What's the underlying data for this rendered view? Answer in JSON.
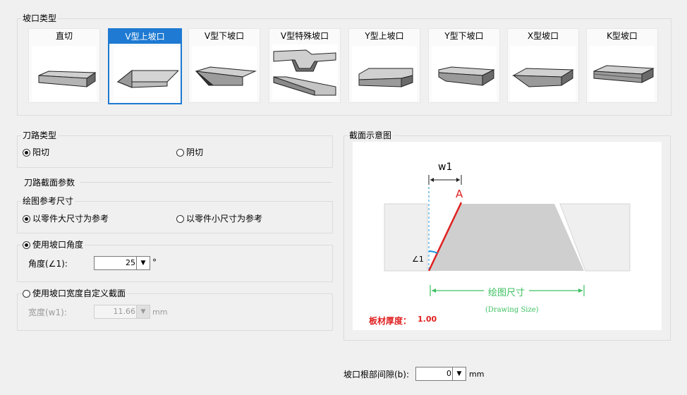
{
  "bevel_type": {
    "title": "坡口类型",
    "options": [
      {
        "label": "直切",
        "icon": "straight-cut-icon",
        "selected": false
      },
      {
        "label": "V型上坡口",
        "icon": "v-upper-bevel-icon",
        "selected": true
      },
      {
        "label": "V型下坡口",
        "icon": "v-lower-bevel-icon",
        "selected": false
      },
      {
        "label": "V型特殊坡口",
        "icon": "v-special-bevel-icon",
        "selected": false
      },
      {
        "label": "Y型上坡口",
        "icon": "y-upper-bevel-icon",
        "selected": false
      },
      {
        "label": "Y型下坡口",
        "icon": "y-lower-bevel-icon",
        "selected": false
      },
      {
        "label": "X型坡口",
        "icon": "x-bevel-icon",
        "selected": false
      },
      {
        "label": "K型坡口",
        "icon": "k-bevel-icon",
        "selected": false
      }
    ]
  },
  "toolpath_type": {
    "title": "刀路类型",
    "options": [
      {
        "label": "阳切",
        "selected": true
      },
      {
        "label": "阴切",
        "selected": false
      }
    ]
  },
  "section_params": {
    "title": "刀路截面参数",
    "ref_title": "绘图参考尺寸",
    "ref_options": [
      {
        "label": "以零件大尺寸为参考",
        "selected": true
      },
      {
        "label": "以零件小尺寸为参考",
        "selected": false
      }
    ],
    "angle_mode": {
      "label": "使用坡口角度",
      "selected": true,
      "field_label": "角度(∠1):",
      "value": "25",
      "unit": "°"
    },
    "width_mode": {
      "label": "使用坡口宽度自定义截面",
      "selected": false,
      "field_label": "宽度(w1):",
      "value": "11.66",
      "unit": "mm"
    }
  },
  "diagram": {
    "title": "截面示意图",
    "w1_label": "w1",
    "point_label": "A",
    "angle_label": "∠1",
    "size_label": "绘图尺寸",
    "size_sub": "(Drawing Size)",
    "thickness_label": "板材厚度：",
    "thickness_value": "1.00",
    "colors": {
      "red": "#e02020",
      "green": "#3cc060",
      "blue": "#1e90d8"
    }
  },
  "root_gap": {
    "label": "坡口根部间隙(b):",
    "value": "0",
    "unit": "mm"
  }
}
